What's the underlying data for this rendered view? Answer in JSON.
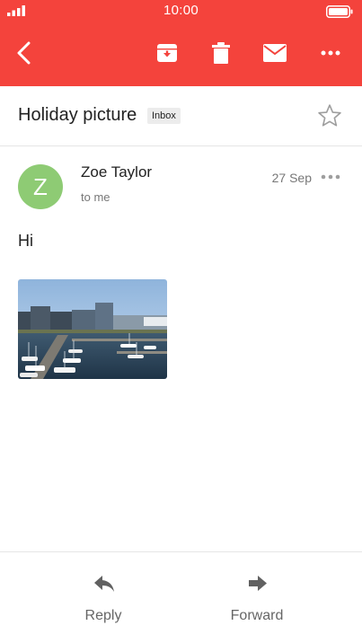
{
  "status_bar": {
    "time": "10:00",
    "signal_icon": "signal-bars-icon",
    "battery_icon": "battery-icon"
  },
  "toolbar": {
    "back_icon": "back-arrow-icon",
    "archive_icon": "archive-icon",
    "delete_icon": "trash-icon",
    "mail_icon": "envelope-icon",
    "more_icon": "more-horizontal-icon",
    "accent_color": "#f4433c"
  },
  "email": {
    "subject": "Holiday picture",
    "label": "Inbox",
    "star_icon": "star-outline-icon",
    "sender_initial": "Z",
    "sender_name": "Zoe Taylor",
    "recipient": "to me",
    "date": "27 Sep",
    "body": "Hi",
    "avatar_color": "#8ecb74",
    "attachment_icon": "photo-thumbnail"
  },
  "actions": {
    "reply_label": "Reply",
    "reply_icon": "reply-icon",
    "forward_label": "Forward",
    "forward_icon": "forward-icon"
  }
}
